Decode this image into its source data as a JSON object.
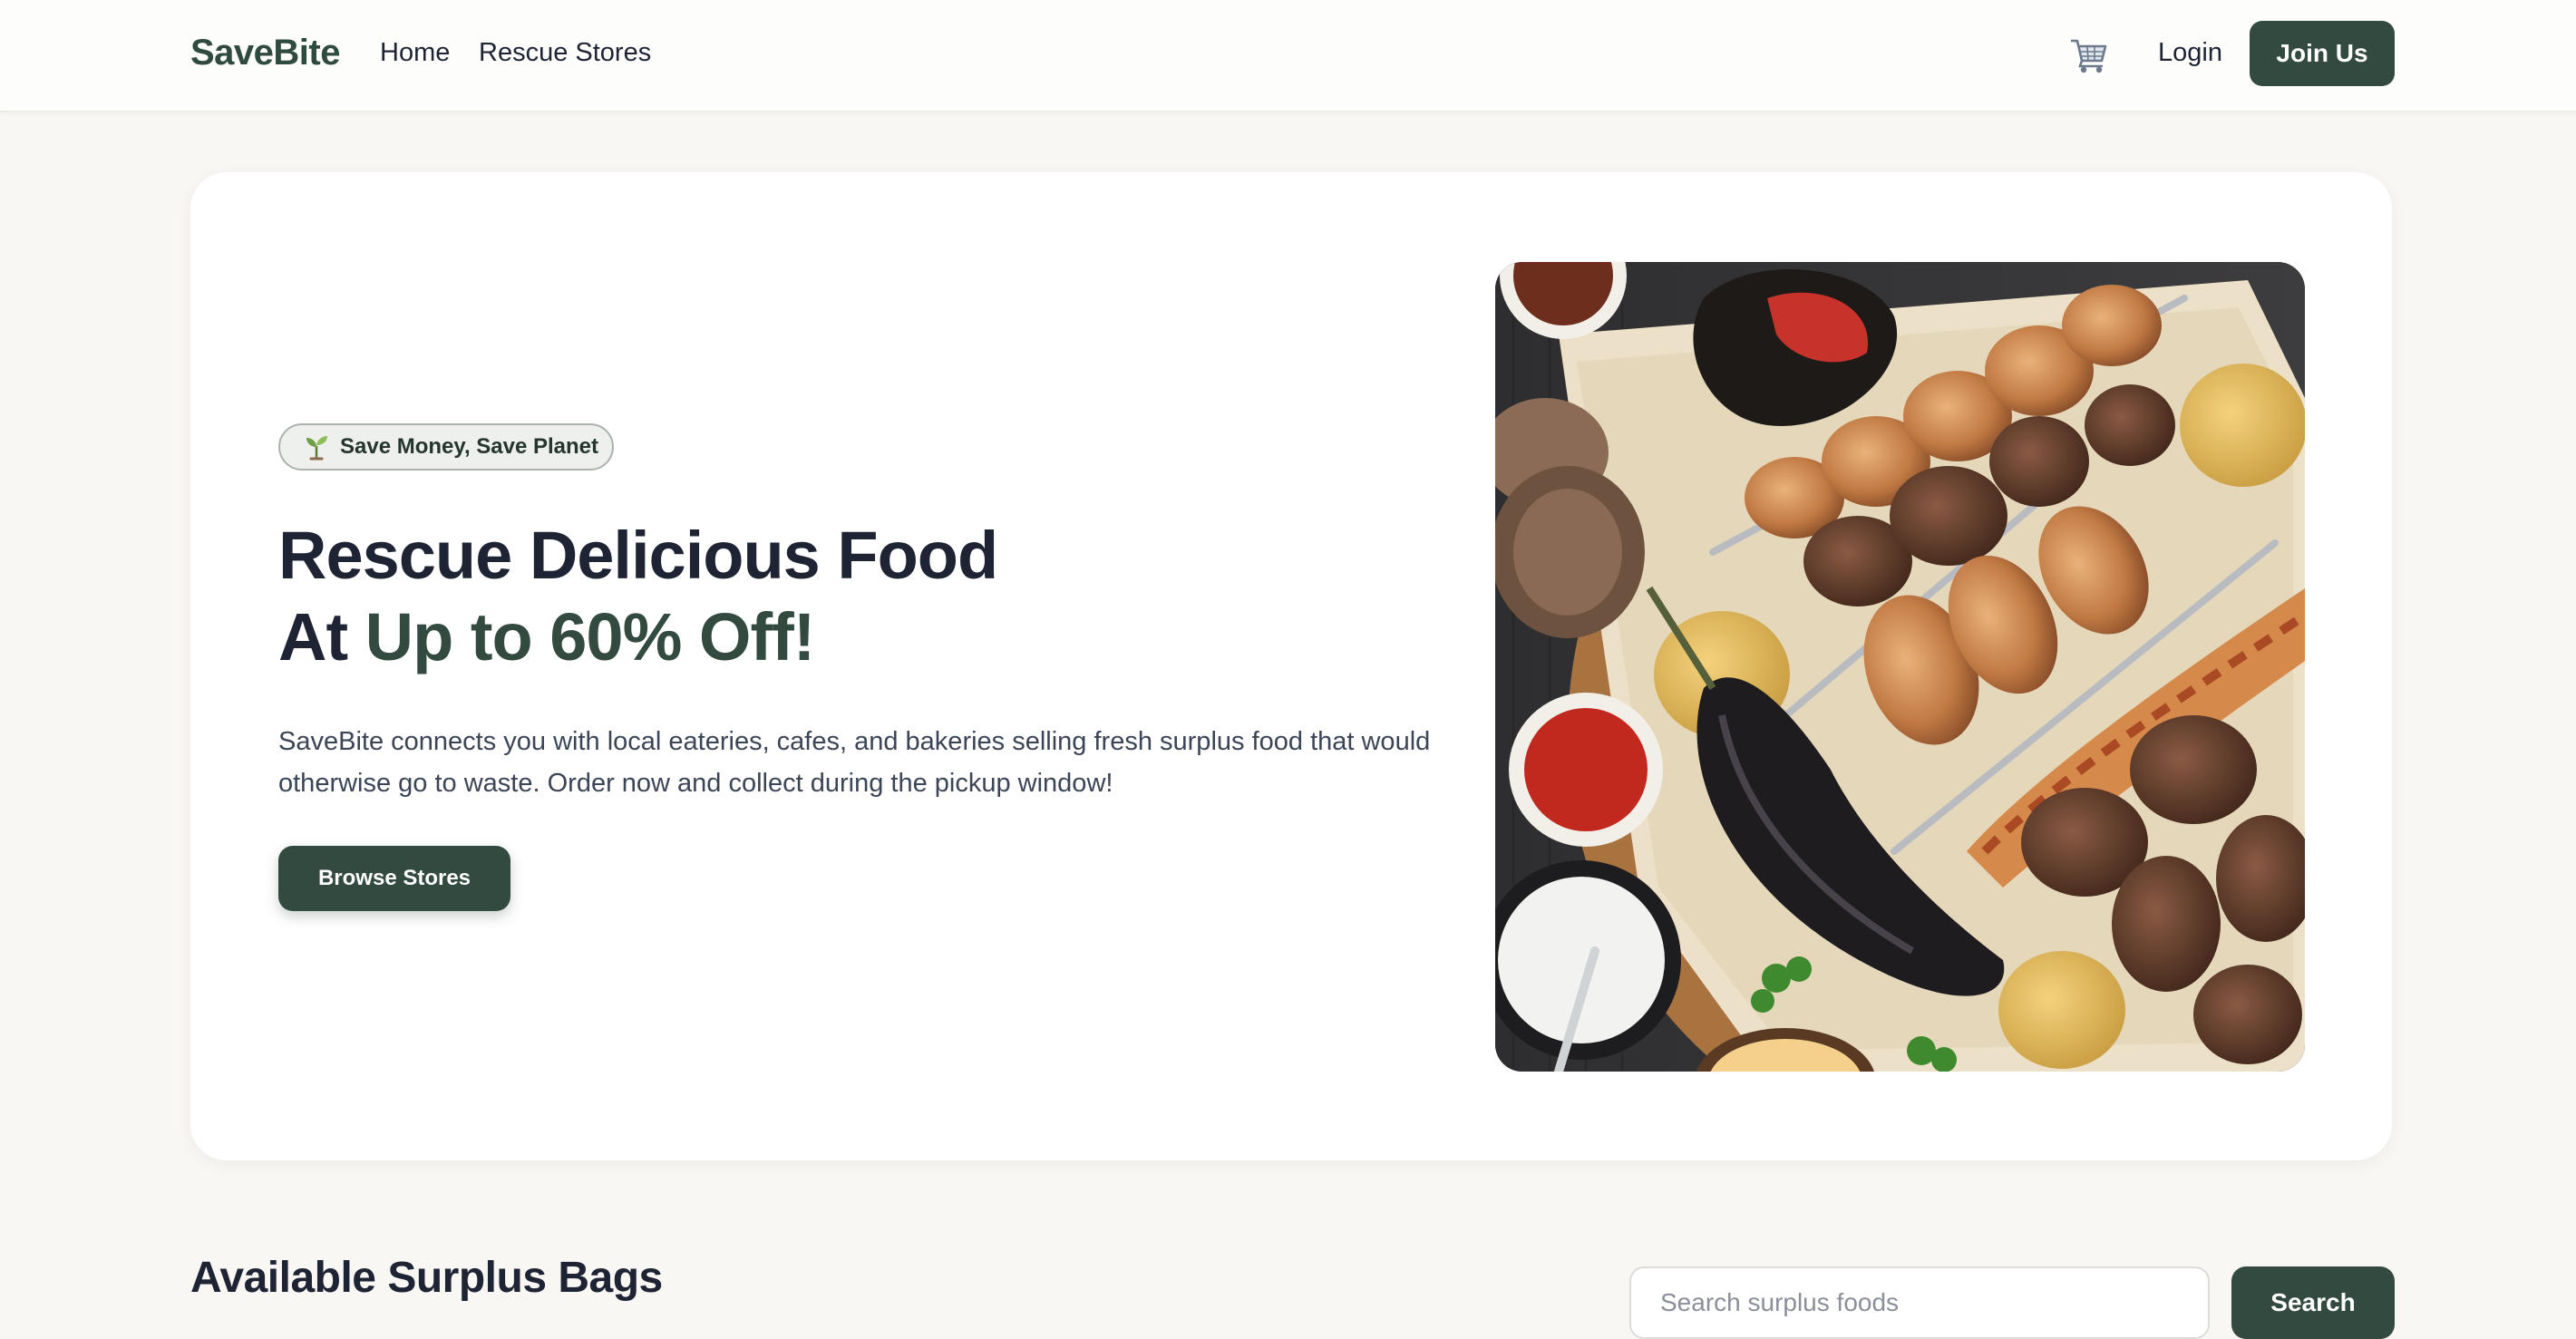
{
  "nav": {
    "logo": "SaveBite",
    "links": [
      {
        "label": "Home"
      },
      {
        "label": "Rescue Stores"
      }
    ],
    "cart_icon": "cart-icon",
    "login_label": "Login",
    "join_label": "Join Us"
  },
  "hero": {
    "badge_icon": "seedling-icon",
    "badge_label": "Save Money, Save Planet",
    "title_line1": "Rescue Delicious Food",
    "title_line2_prefix": "At ",
    "title_line2_accent": "Up to 60% Off!",
    "description": "SaveBite connects you with local eateries, cafes, and bakeries selling fresh surplus food that would otherwise go to waste. Order now and collect during the pickup window!",
    "cta_label": "Browse Stores",
    "image_subject": "grilled-meat-platter-photo"
  },
  "surplus": {
    "title": "Available Surplus Bags",
    "search_placeholder": "Search surplus foods",
    "search_label": "Search"
  },
  "colors": {
    "brand": "#334a40",
    "text": "#1e2433",
    "background": "#f8f7f4"
  }
}
